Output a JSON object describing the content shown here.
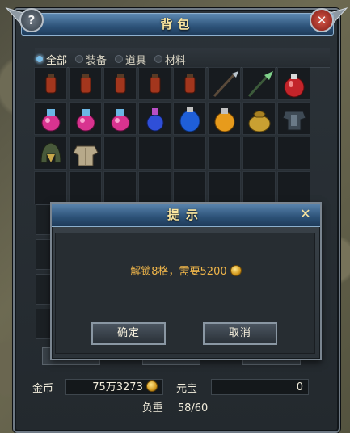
{
  "window": {
    "title": "背包"
  },
  "tabs": [
    {
      "label": "全部",
      "active": true
    },
    {
      "label": "装备",
      "active": false
    },
    {
      "label": "道具",
      "active": false
    },
    {
      "label": "材料",
      "active": false
    }
  ],
  "inventory": [
    {
      "icon": "small-red-potion-icon"
    },
    {
      "icon": "small-red-potion-icon"
    },
    {
      "icon": "small-red-potion-icon"
    },
    {
      "icon": "small-red-potion-icon"
    },
    {
      "icon": "small-red-potion-icon"
    },
    {
      "icon": "dark-spear-icon"
    },
    {
      "icon": "green-spear-icon"
    },
    {
      "icon": "large-red-potion-icon"
    },
    {
      "icon": "pink-potion-icon"
    },
    {
      "icon": "pink-potion-icon"
    },
    {
      "icon": "pink-potion-icon"
    },
    {
      "icon": "blue-potion-icon"
    },
    {
      "icon": "large-blue-potion-icon"
    },
    {
      "icon": "orange-potion-icon"
    },
    {
      "icon": "gold-bag-icon"
    },
    {
      "icon": "dark-armor-icon"
    },
    {
      "icon": "green-helmet-icon"
    },
    {
      "icon": "leather-armor-icon"
    },
    {
      "icon": ""
    },
    {
      "icon": ""
    },
    {
      "icon": ""
    },
    {
      "icon": ""
    },
    {
      "icon": ""
    },
    {
      "icon": ""
    },
    {
      "icon": ""
    },
    {
      "icon": ""
    },
    {
      "icon": ""
    },
    {
      "icon": ""
    },
    {
      "icon": ""
    },
    {
      "icon": ""
    },
    {
      "icon": ""
    },
    {
      "icon": ""
    }
  ],
  "footer": {
    "gold_label": "金币",
    "gold_value": "75万3273",
    "yuanbao_label": "元宝",
    "yuanbao_value": "0",
    "weight_label": "负重",
    "weight_value": "58/60"
  },
  "dialog": {
    "title": "提示",
    "message": "解锁8格，需要5200",
    "ok_label": "确定",
    "cancel_label": "取消"
  },
  "colors": {
    "title_text": "#fbe7a0",
    "message_text": "#f0b64a",
    "active_tab_dot": "#79bde8"
  }
}
